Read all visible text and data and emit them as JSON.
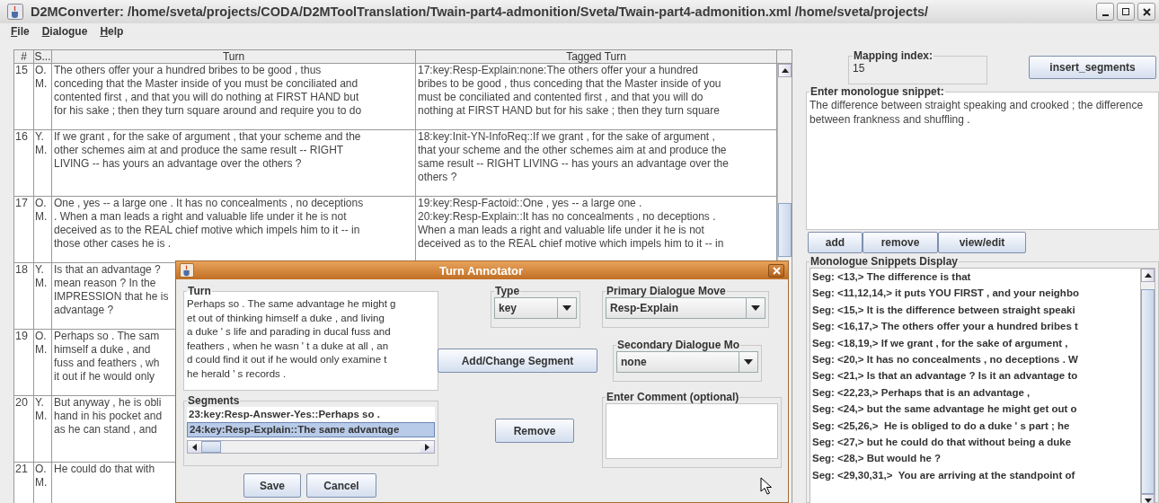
{
  "window": {
    "title": "D2MConverter: /home/sveta/projects/CODA/D2MToolTranslation/Twain-part4-admonition/Sveta/Twain-part4-admonition.xml /home/sveta/projects/"
  },
  "menu": [
    "File",
    "Dialogue",
    "Help"
  ],
  "table": {
    "columns": [
      "#",
      "S...",
      "Turn",
      "Tagged Turn"
    ],
    "rows": [
      {
        "number": "15",
        "speaker": "O. M.",
        "turn": [
          "The others offer your a hundred bribes to be good , thus",
          "conceding that the Master inside of you must be conciliated and",
          "contented first , and that you will do nothing at FIRST HAND but",
          "for his sake ; then they turn square around and require you to do"
        ],
        "tagged_turn": [
          "17:key:Resp-Explain:none:The others offer your a hundred",
          "bribes to be good , thus conceding that the Master inside of you",
          "must be conciliated and contented first , and that you will do",
          "nothing at FIRST HAND but for his sake ; then they turn square"
        ]
      },
      {
        "number": "16",
        "speaker": "Y. M.",
        "turn": [
          "If we grant , for the sake of argument , that your scheme and the",
          "other schemes aim at and produce the same result -- RIGHT",
          "LIVING -- has yours an advantage over the others ?"
        ],
        "tagged_turn": [
          "18:key:Init-YN-InfoReq::If we grant , for the sake of argument ,",
          "that your scheme and the other schemes aim at and produce the",
          "same result -- RIGHT LIVING -- has yours an advantage over the",
          "others ?"
        ]
      },
      {
        "number": "17",
        "speaker": "O. M.",
        "turn": [
          "One , yes -- a large one . It has no concealments , no deceptions",
          ". When a man leads a right and valuable life under it he is not",
          "deceived as to the REAL chief motive which impels him to it -- in",
          "those other cases he is ."
        ],
        "tagged_turn": [
          "19:key:Resp-Factoid::One , yes -- a large one .",
          "20:key:Resp-Explain::It has no concealments , no deceptions .",
          "When a man leads a right and valuable life under it he is not",
          "deceived as to the REAL chief motive which impels him to it -- in"
        ]
      },
      {
        "number": "18",
        "speaker": "Y. M.",
        "turn": [
          "Is that an advantage ?",
          "mean reason ? In the",
          "IMPRESSION that he is",
          "advantage ?"
        ]
      },
      {
        "number": "19",
        "speaker": "O. M.",
        "turn": [
          "Perhaps so . The sam",
          "himself a duke , and",
          "fuss and feathers , wh",
          "it out if he would only"
        ]
      },
      {
        "number": "20",
        "speaker": "Y. M.",
        "turn": [
          "But anyway , he is obli",
          "hand in his pocket and",
          "as he can stand , and"
        ]
      },
      {
        "number": "21",
        "speaker": "O. M.",
        "turn": [
          "He could do that with"
        ]
      }
    ]
  },
  "mapping_index": {
    "label": "Mapping index:",
    "value": "15"
  },
  "insert_button": "insert_segments",
  "snippet": {
    "label": "Enter monologue snippet:",
    "value": "The difference between straight speaking and crooked ; the difference between frankness and shuffling ."
  },
  "snippet_buttons": [
    "add",
    "remove",
    "view/edit"
  ],
  "snippets_display": {
    "title": "Monologue Snippets Display",
    "items": [
      "Seg: <13,> The difference is that",
      "Seg: <11,12,14,> it puts YOU FIRST , and your neighbo",
      "Seg: <15,> It is the difference between straight speaki",
      "Seg: <16,17,> The others offer your a hundred bribes t",
      "Seg: <18,19,> If we grant , for the sake of argument ,",
      "Seg: <20,> It has no concealments , no deceptions . W",
      "Seg: <21,> Is that an advantage ? Is it an advantage to",
      "Seg: <22,23,> Perhaps that is an advantage ,",
      "Seg: <24,> but the same advantage he might get out o",
      "Seg: <25,26,>  He is obliged to do a duke ' s part ; he",
      "Seg: <27,> but he could do that without being a duke",
      "Seg: <28,> But would he ?",
      "Seg: <29,30,31,>  You are arriving at the standpoint of"
    ]
  },
  "dialog": {
    "title": "Turn Annotator",
    "turn": {
      "label": "Turn",
      "lines": [
        "Perhaps so . The same advantage he might g",
        "et out of thinking himself a duke , and living",
        "a duke ' s life and parading in ducal fuss and",
        "feathers , when he wasn ' t a duke at all , an",
        "d could find it out if he would only examine t",
        "he herald ' s records ."
      ]
    },
    "segments": {
      "label": "Segments",
      "items": [
        {
          "text": "23:key:Resp-Answer-Yes::Perhaps so .",
          "selected": false
        },
        {
          "text": "24:key:Resp-Explain::The same advantage",
          "selected": true
        }
      ]
    },
    "type": {
      "label": "Type",
      "value": "key"
    },
    "primary": {
      "label": "Primary Dialogue Move",
      "value": "Resp-Explain"
    },
    "secondary": {
      "label": "Secondary Dialogue Mo",
      "value": "none"
    },
    "comment": {
      "label": "Enter Comment (optional)"
    },
    "add_change_button": "Add/Change Segment",
    "remove_button": "Remove",
    "save_button": "Save",
    "cancel_button": "Cancel"
  }
}
